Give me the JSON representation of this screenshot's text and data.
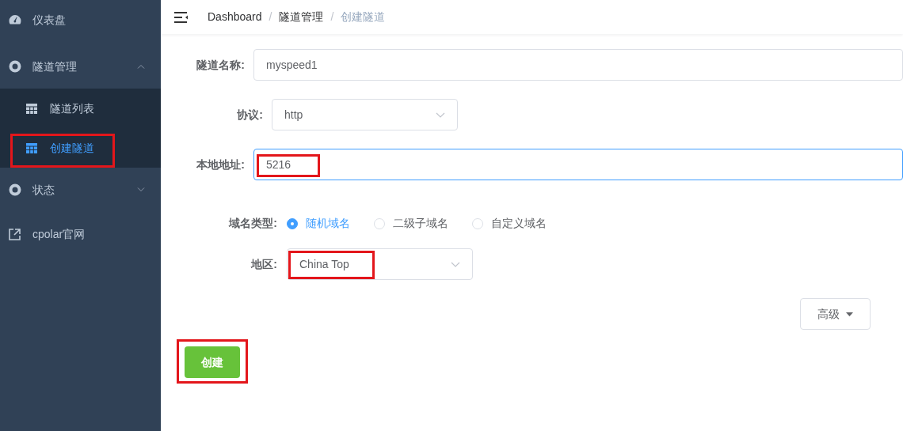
{
  "sidebar": {
    "items": [
      {
        "label": "仪表盘",
        "selected": false,
        "highlighted": false
      },
      {
        "label": "隧道管理",
        "expanded": true,
        "selected": false,
        "highlighted": false,
        "children": [
          {
            "label": "隧道列表",
            "selected": false,
            "highlighted": false
          },
          {
            "label": "创建隧道",
            "selected": true,
            "highlighted": true
          }
        ]
      },
      {
        "label": "状态",
        "expanded": false,
        "selected": false,
        "highlighted": false
      },
      {
        "label": "cpolar官网",
        "selected": false,
        "highlighted": false
      }
    ]
  },
  "breadcrumb": [
    {
      "label": "Dashboard",
      "current": false
    },
    {
      "label": "隧道管理",
      "current": false
    },
    {
      "label": "创建隧道",
      "current": true
    }
  ],
  "breadcrumb_separator": "/",
  "form": {
    "fields": [
      {
        "kind": "input",
        "label": "隧道名称:",
        "value": "myspeed1",
        "focused": false,
        "highlighted": false
      },
      {
        "kind": "select",
        "label": "协议:",
        "value": "http",
        "focused": false,
        "highlighted": false
      },
      {
        "kind": "input",
        "label": "本地地址:",
        "value": "5216",
        "focused": true,
        "highlighted": true
      },
      {
        "kind": "radio",
        "label": "域名类型:",
        "options": [
          {
            "label": "随机域名",
            "selected": true
          },
          {
            "label": "二级子域名",
            "selected": false
          },
          {
            "label": "自定义域名",
            "selected": false
          }
        ]
      },
      {
        "kind": "select",
        "label": "地区:",
        "value": "China Top",
        "focused": false,
        "highlighted": true
      }
    ],
    "advanced_button": "高级",
    "submit_button": {
      "label": "创建",
      "highlighted": true
    }
  }
}
